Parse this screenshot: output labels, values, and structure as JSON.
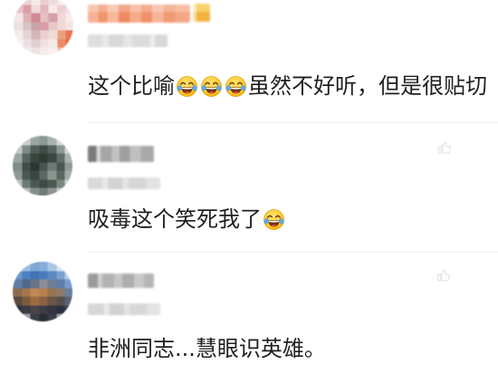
{
  "comments": [
    {
      "segments": [
        "这个比喻",
        {
          "emoji": "face-with-tears-of-joy-icon"
        },
        {
          "emoji": "face-with-tears-of-joy-icon"
        },
        {
          "emoji": "face-with-tears-of-joy-icon"
        },
        "虽然不好听，但是很贴切"
      ]
    },
    {
      "segments": [
        "吸毒这个笑死我了",
        {
          "emoji": "face-with-tears-of-joy-icon"
        }
      ],
      "like_icon": "thumbs-up-icon"
    },
    {
      "segments": [
        "非洲同志...慧眼识英雄。"
      ],
      "like_icon": "thumbs-up-icon"
    }
  ],
  "colors": {
    "text": "#1f1f1f",
    "separator": "#efefef",
    "like_icon": "#e2e2e2"
  }
}
